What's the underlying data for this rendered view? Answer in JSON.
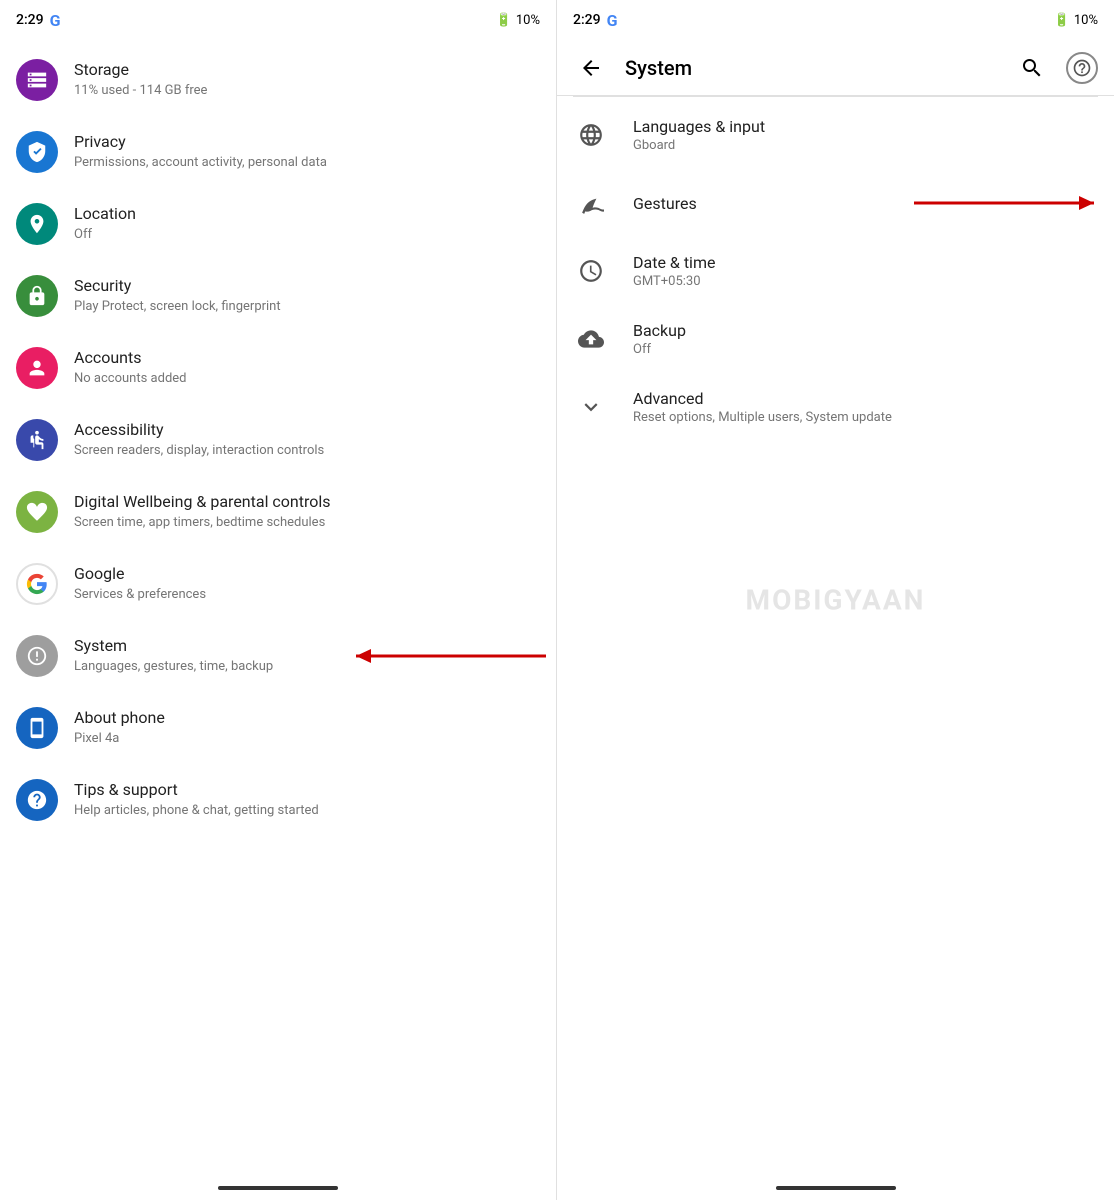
{
  "left": {
    "statusBar": {
      "time": "2:29",
      "googleLogo": "G",
      "batteryIcon": "🔋",
      "batteryPct": "10%"
    },
    "items": [
      {
        "id": "storage",
        "icon": "storage",
        "iconColor": "icon-purple",
        "title": "Storage",
        "subtitle": "11% used - 114 GB free"
      },
      {
        "id": "privacy",
        "icon": "privacy",
        "iconColor": "icon-blue",
        "title": "Privacy",
        "subtitle": "Permissions, account activity, personal data"
      },
      {
        "id": "location",
        "icon": "location",
        "iconColor": "icon-teal",
        "title": "Location",
        "subtitle": "Off"
      },
      {
        "id": "security",
        "icon": "security",
        "iconColor": "icon-green",
        "title": "Security",
        "subtitle": "Play Protect, screen lock, fingerprint"
      },
      {
        "id": "accounts",
        "icon": "accounts",
        "iconColor": "icon-pink",
        "title": "Accounts",
        "subtitle": "No accounts added"
      },
      {
        "id": "accessibility",
        "icon": "accessibility",
        "iconColor": "icon-indigo",
        "title": "Accessibility",
        "subtitle": "Screen readers, display, interaction controls"
      },
      {
        "id": "wellbeing",
        "icon": "wellbeing",
        "iconColor": "icon-lime",
        "title": "Digital Wellbeing & parental controls",
        "subtitle": "Screen time, app timers, bedtime schedules"
      },
      {
        "id": "google",
        "icon": "google",
        "iconColor": "icon-google",
        "title": "Google",
        "subtitle": "Services & preferences"
      },
      {
        "id": "system",
        "icon": "system",
        "iconColor": "icon-gray",
        "title": "System",
        "subtitle": "Languages, gestures, time, backup",
        "hasArrow": true
      },
      {
        "id": "about",
        "icon": "about",
        "iconColor": "icon-dark-blue",
        "title": "About phone",
        "subtitle": "Pixel 4a"
      },
      {
        "id": "tips",
        "icon": "tips",
        "iconColor": "icon-dark-blue",
        "title": "Tips & support",
        "subtitle": "Help articles, phone & chat, getting started"
      }
    ]
  },
  "right": {
    "statusBar": {
      "time": "2:29",
      "googleLogo": "G",
      "batteryPct": "10%"
    },
    "header": {
      "title": "System",
      "backLabel": "←",
      "searchLabel": "search",
      "helpLabel": "?"
    },
    "items": [
      {
        "id": "languages",
        "title": "Languages & input",
        "subtitle": "Gboard"
      },
      {
        "id": "gestures",
        "title": "Gestures",
        "subtitle": "",
        "hasArrow": true
      },
      {
        "id": "datetime",
        "title": "Date & time",
        "subtitle": "GMT+05:30"
      },
      {
        "id": "backup",
        "title": "Backup",
        "subtitle": "Off"
      },
      {
        "id": "advanced",
        "title": "Advanced",
        "subtitle": "Reset options, Multiple users, System update",
        "isCollapsed": true
      }
    ]
  },
  "watermark": "MOBIGYAAN"
}
